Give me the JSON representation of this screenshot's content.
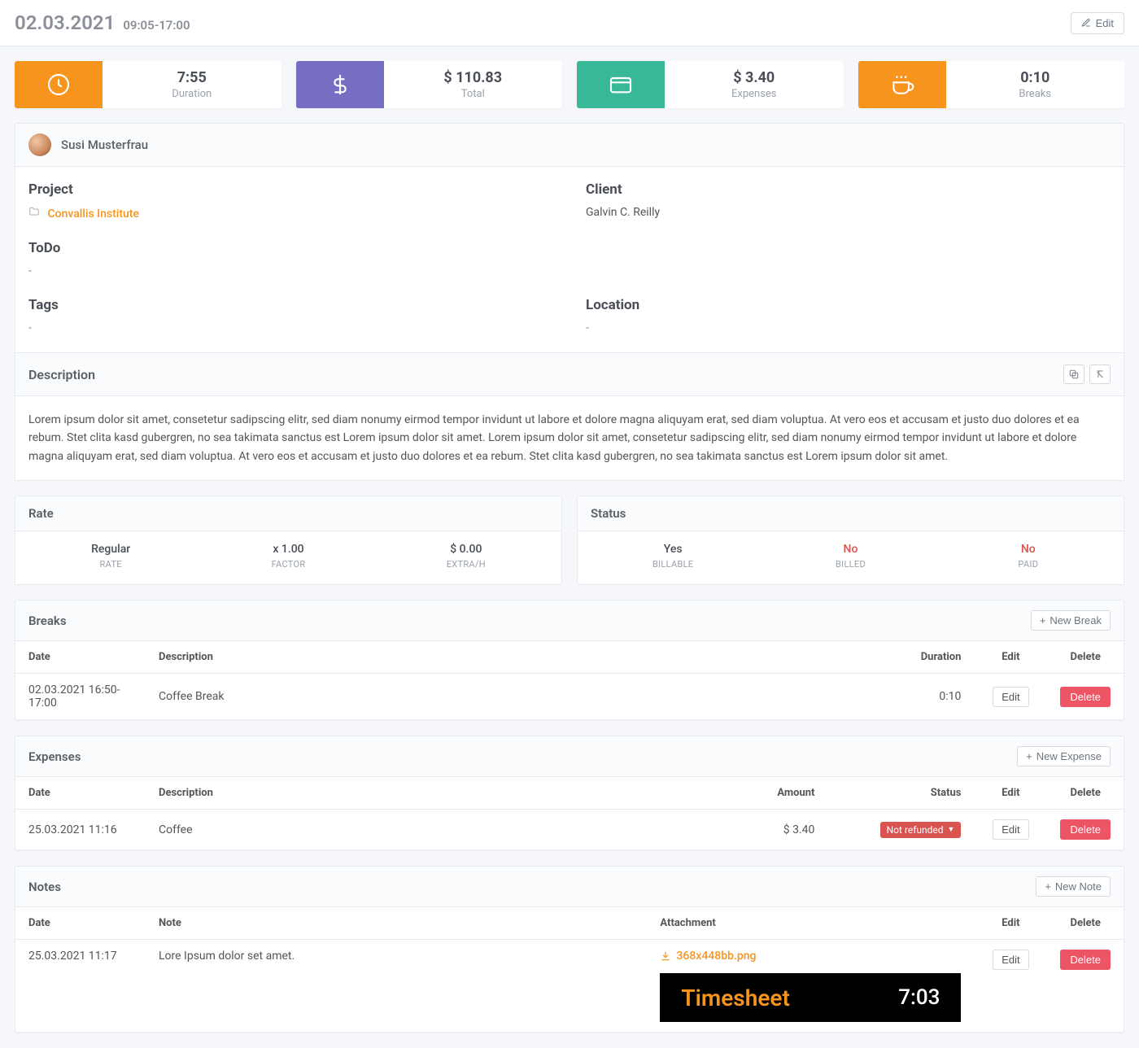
{
  "header": {
    "date": "02.03.2021",
    "time": "09:05-17:00",
    "edit_label": "Edit"
  },
  "stats": {
    "duration": {
      "value": "7:55",
      "label": "Duration"
    },
    "total": {
      "value": "$ 110.83",
      "label": "Total"
    },
    "expenses": {
      "value": "$ 3.40",
      "label": "Expenses"
    },
    "breaks": {
      "value": "0:10",
      "label": "Breaks"
    }
  },
  "user": {
    "name": "Susi Musterfrau"
  },
  "info": {
    "project": {
      "label": "Project",
      "value": "Convallis Institute"
    },
    "client": {
      "label": "Client",
      "value": "Galvin C. Reilly"
    },
    "todo": {
      "label": "ToDo",
      "value": "-"
    },
    "tags": {
      "label": "Tags",
      "value": "-"
    },
    "location": {
      "label": "Location",
      "value": "-"
    }
  },
  "description": {
    "label": "Description",
    "text": "Lorem ipsum dolor sit amet, consetetur sadipscing elitr, sed diam nonumy eirmod tempor invidunt ut labore et dolore magna aliquyam erat, sed diam voluptua. At vero eos et accusam et justo duo dolores et ea rebum. Stet clita kasd gubergren, no sea takimata sanctus est Lorem ipsum dolor sit amet. Lorem ipsum dolor sit amet, consetetur sadipscing elitr, sed diam nonumy eirmod tempor invidunt ut labore et dolore magna aliquyam erat, sed diam voluptua. At vero eos et accusam et justo duo dolores et ea rebum. Stet clita kasd gubergren, no sea takimata sanctus est Lorem ipsum dolor sit amet."
  },
  "rate": {
    "label": "Rate",
    "items": [
      {
        "value": "Regular",
        "label": "RATE"
      },
      {
        "value": "x 1.00",
        "label": "FACTOR"
      },
      {
        "value": "$ 0.00",
        "label": "EXTRA/H"
      }
    ]
  },
  "status": {
    "label": "Status",
    "items": [
      {
        "value": "Yes",
        "label": "BILLABLE",
        "red": false
      },
      {
        "value": "No",
        "label": "BILLED",
        "red": true
      },
      {
        "value": "No",
        "label": "PAID",
        "red": true
      }
    ]
  },
  "breaks": {
    "label": "Breaks",
    "new_label": "New Break",
    "columns": {
      "date": "Date",
      "desc": "Description",
      "duration": "Duration",
      "edit": "Edit",
      "del": "Delete"
    },
    "rows": [
      {
        "date": "02.03.2021 16:50-17:00",
        "desc": "Coffee Break",
        "duration": "0:10"
      }
    ]
  },
  "expenses": {
    "label": "Expenses",
    "new_label": "New Expense",
    "columns": {
      "date": "Date",
      "desc": "Description",
      "amount": "Amount",
      "status": "Status",
      "edit": "Edit",
      "del": "Delete"
    },
    "rows": [
      {
        "date": "25.03.2021 11:16",
        "desc": "Coffee",
        "amount": "$ 3.40",
        "status": "Not refunded"
      }
    ]
  },
  "notes": {
    "label": "Notes",
    "new_label": "New Note",
    "columns": {
      "date": "Date",
      "note": "Note",
      "attach": "Attachment",
      "edit": "Edit",
      "del": "Delete"
    },
    "rows": [
      {
        "date": "25.03.2021 11:17",
        "note": "Lore Ipsum dolor set amet.",
        "attachment": "368x448bb.png"
      }
    ]
  },
  "common": {
    "edit": "Edit",
    "delete": "Delete"
  },
  "preview": {
    "title": "Timesheet",
    "time": "7:03"
  }
}
